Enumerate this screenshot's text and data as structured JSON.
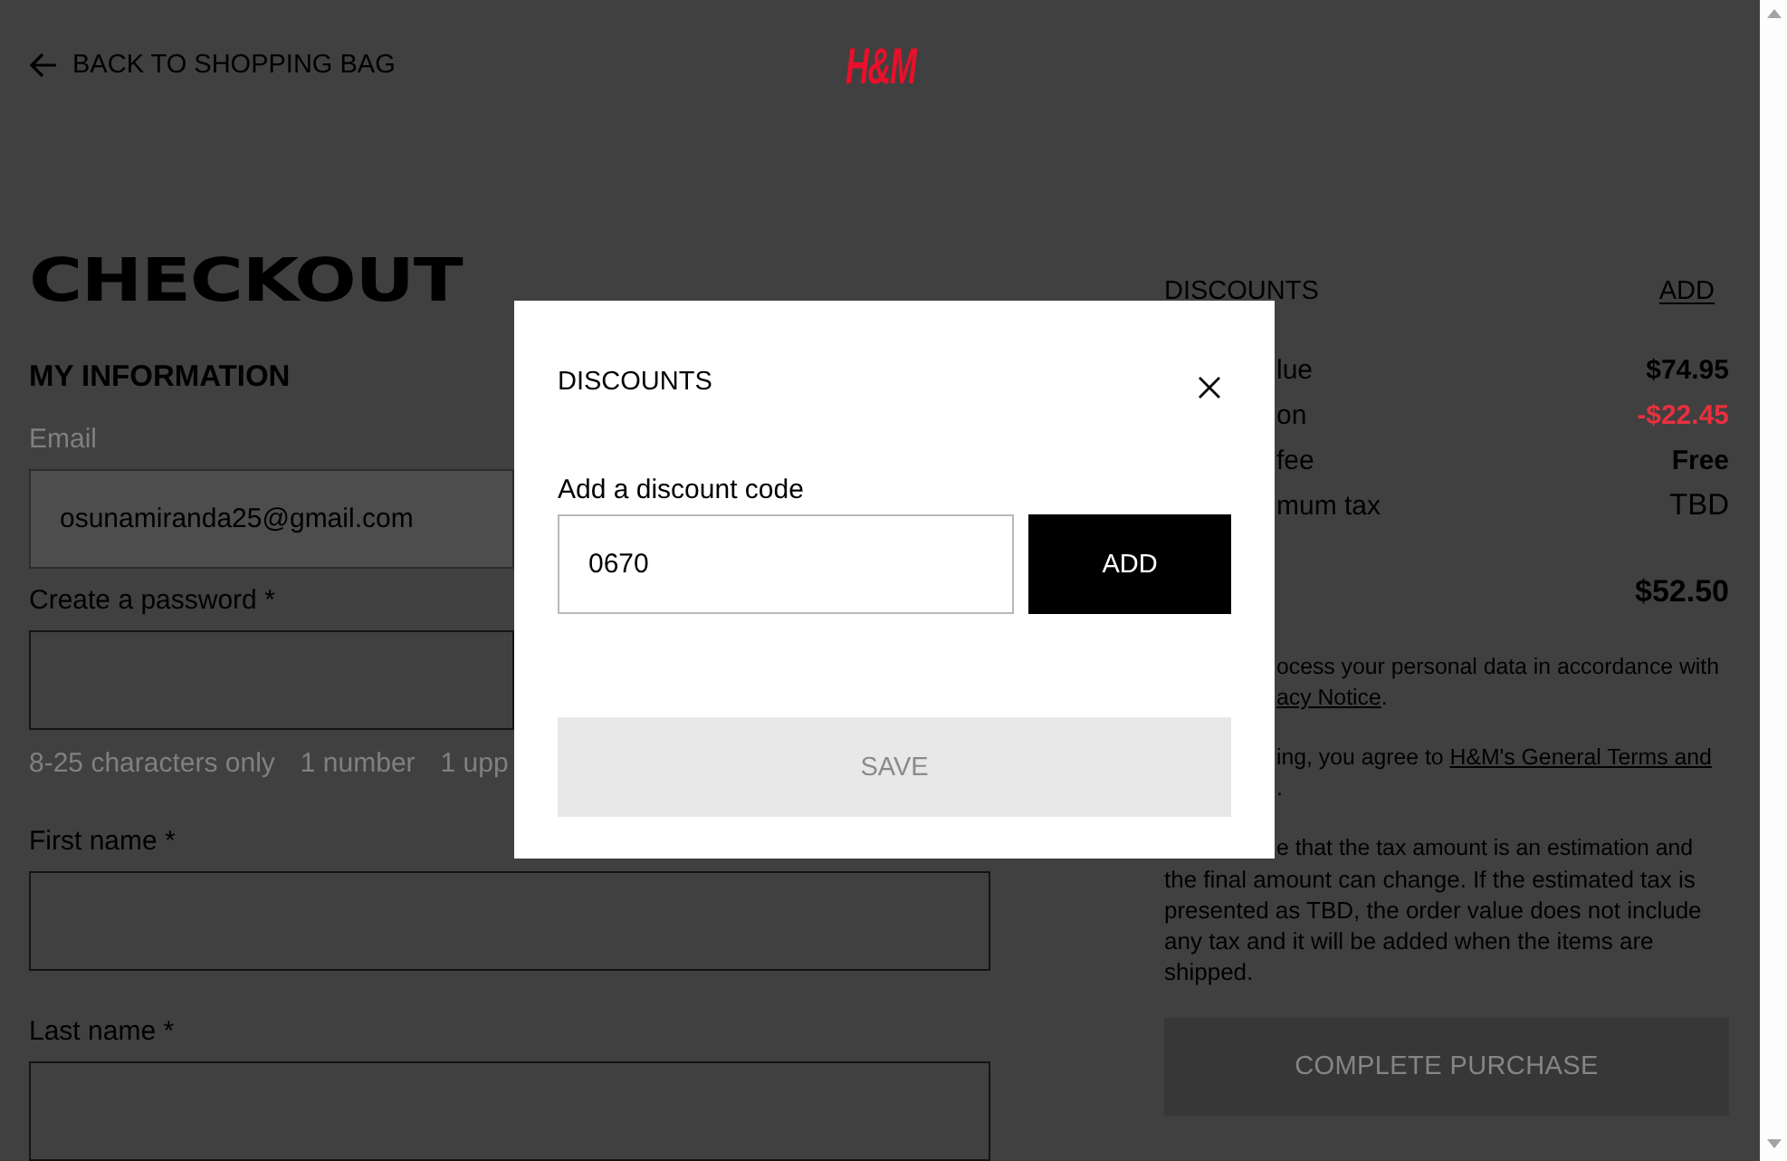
{
  "header": {
    "back_link": "BACK TO SHOPPING BAG",
    "logo": "H&M"
  },
  "checkout": {
    "title": "CHECKOUT",
    "section_title": "MY INFORMATION",
    "fields": [
      {
        "label": "Email",
        "value": "osunamiranda25@gmail.com",
        "disabled": true
      },
      {
        "label": "Create a password *",
        "disabled": false,
        "hints": [
          "8-25 characters only",
          "1 number",
          "1 upp"
        ]
      },
      {
        "label": "First name *",
        "disabled": false
      },
      {
        "label": "Last name *",
        "disabled": false
      }
    ]
  },
  "summary": {
    "heading": "DISCOUNTS",
    "add_link": "ADD",
    "rows": [
      {
        "kind": "amount",
        "label": "lue",
        "value": "$74.95"
      },
      {
        "kind": "discount",
        "label": "on",
        "value": "-$22.45"
      },
      {
        "kind": "amount",
        "label": "fee",
        "value": "Free"
      },
      {
        "kind": "tax",
        "label": "mum tax",
        "value": "TBD"
      },
      {
        "kind": "total",
        "value": "$52.50"
      }
    ],
    "privacy_note": {
      "text": "ocess your personal data in accordance with",
      "link": "acy Notice",
      "end": "."
    },
    "terms_note": {
      "text": "ing, you agree to ",
      "link": "H&M's General Terms and",
      "end": "."
    },
    "tax_note": {
      "beside_dialog": "e that the tax amount is an estimation and",
      "rest": "the final amount can change. If the estimated tax is presented as TBD, the order value does not include any tax and it will be added when the items are shipped."
    },
    "complete_button": {
      "label": "COMPLETE PURCHASE",
      "disabled": true
    }
  },
  "dialog": {
    "title": "DISCOUNTS",
    "code_label": "Add a discount code",
    "code_value": "0670",
    "add_button": "ADD",
    "save_button": {
      "label": "SAVE",
      "disabled": true
    }
  }
}
